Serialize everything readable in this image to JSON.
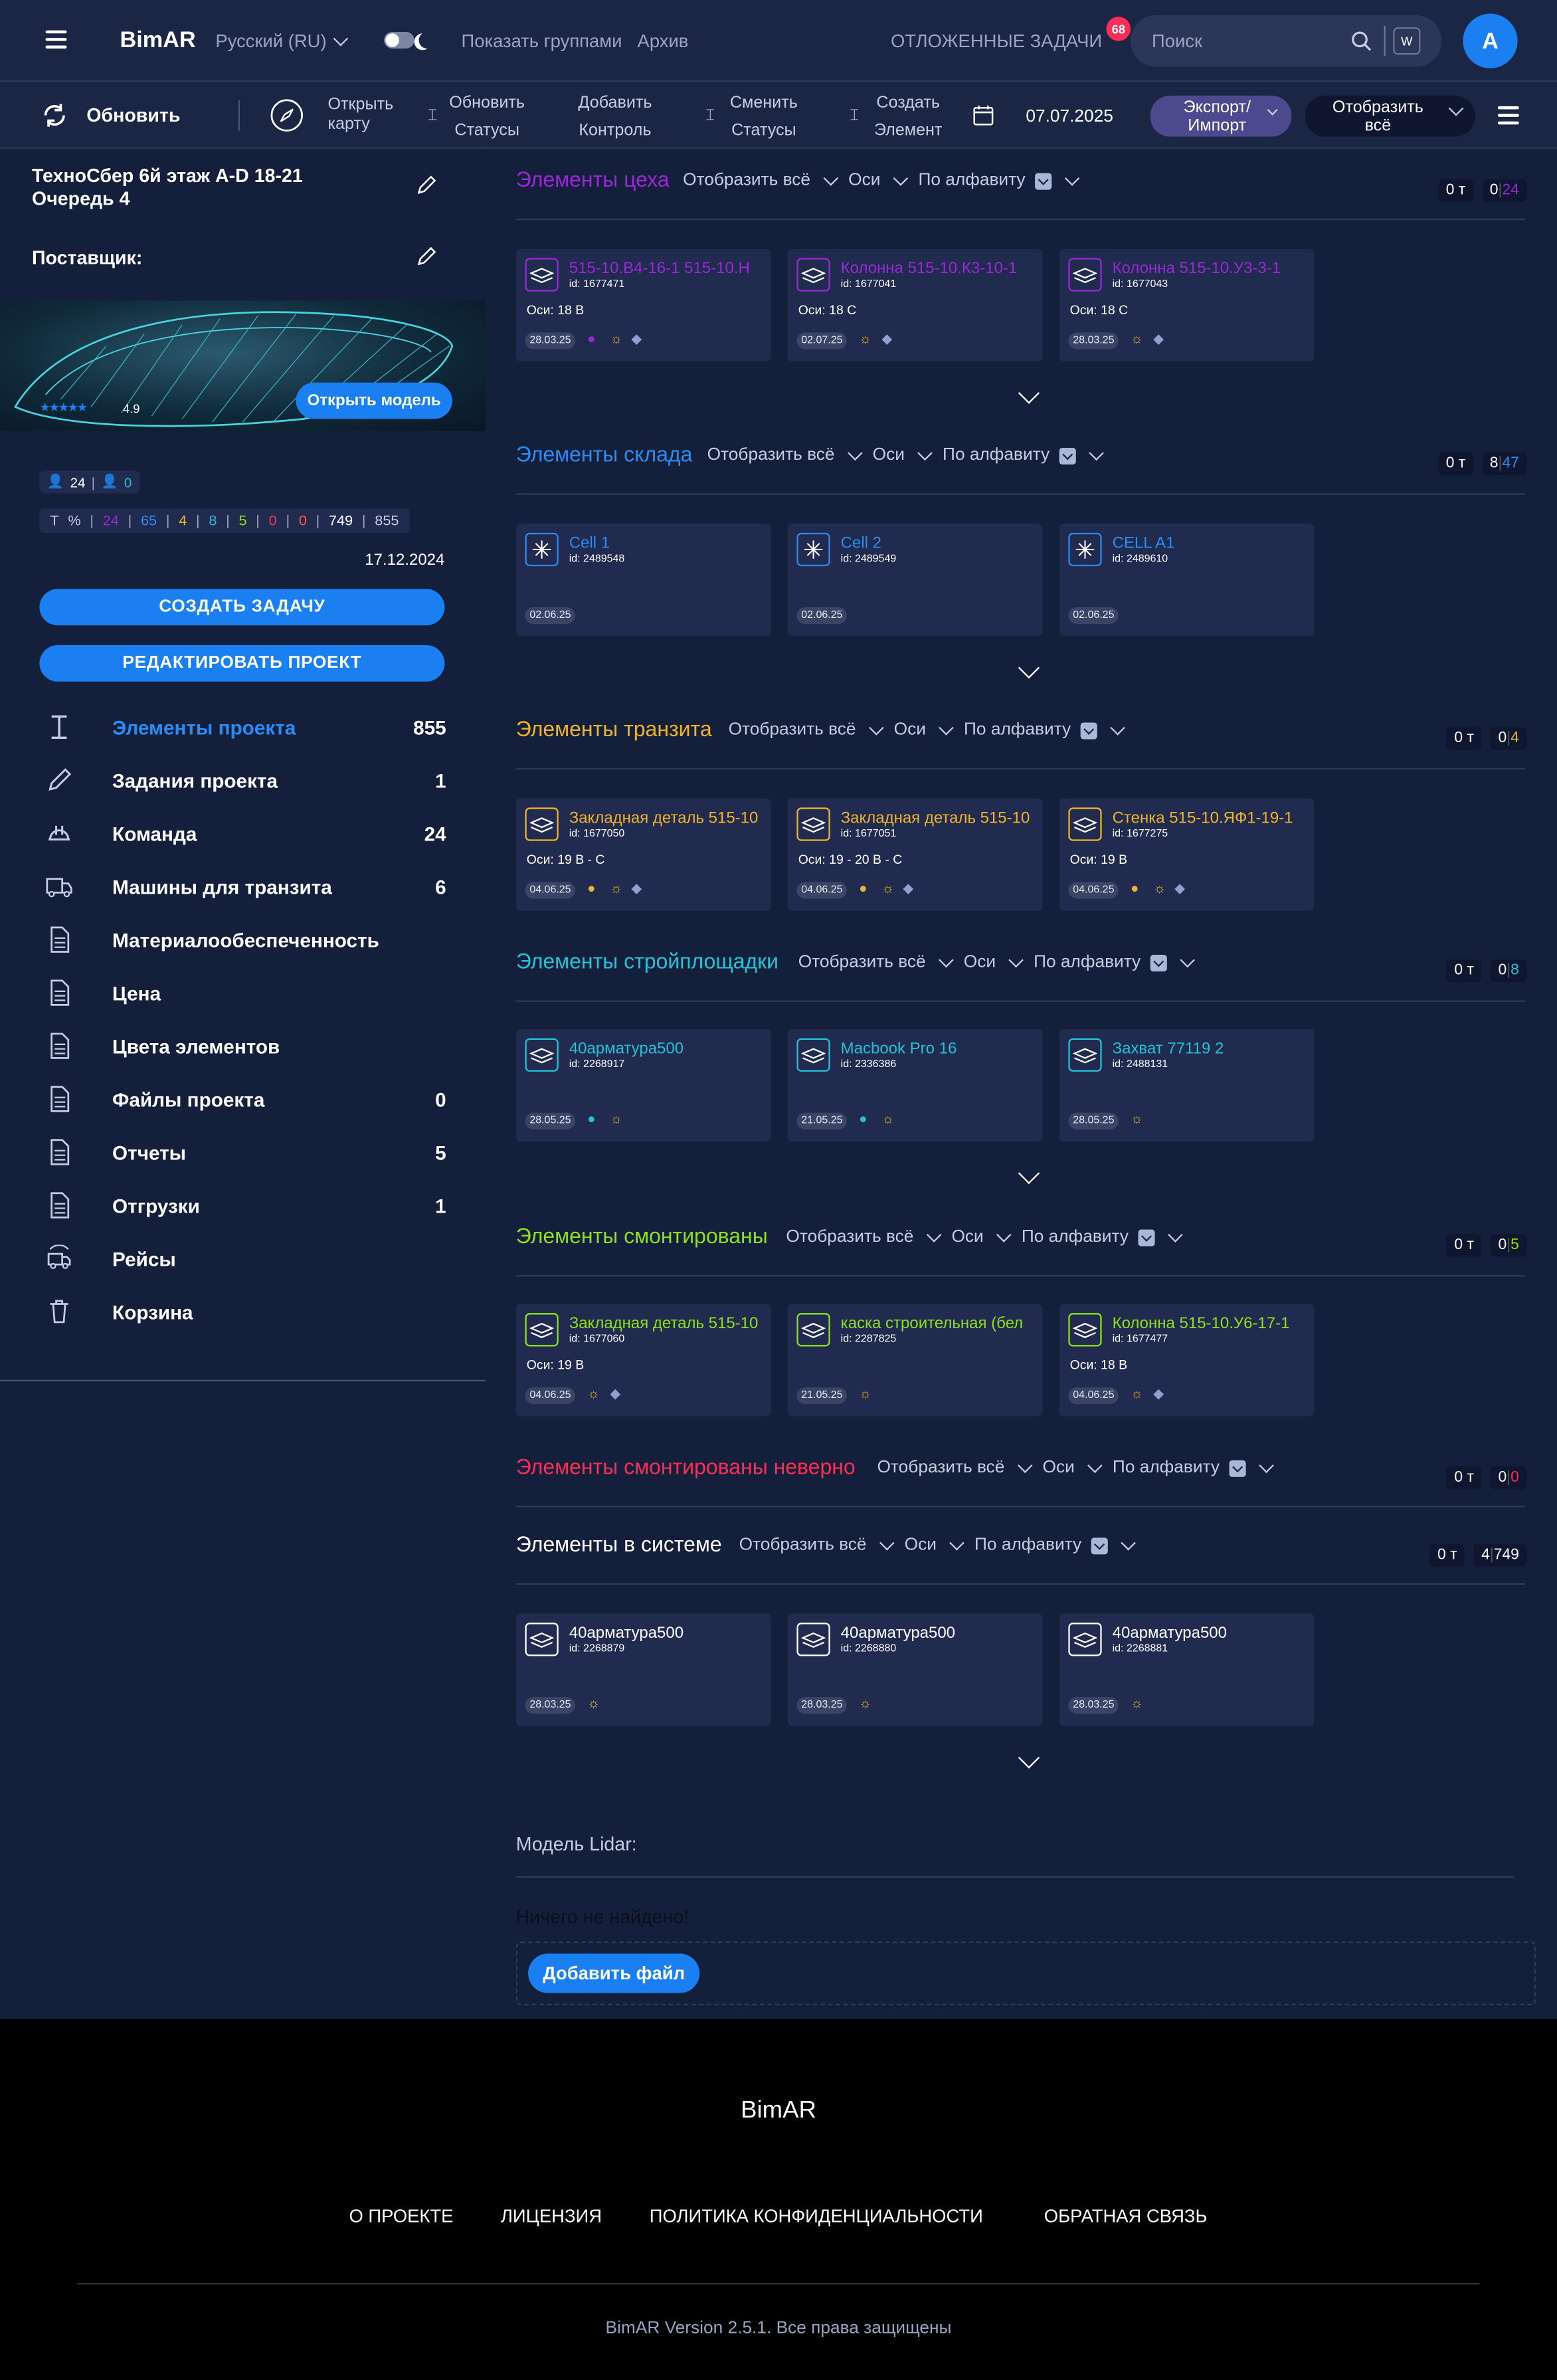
{
  "topbar": {
    "brand": "BimAR",
    "language": "Русский (RU)",
    "show_groups": "Показать группами",
    "archive": "Архив",
    "deferred_tasks": "ОТЛОЖЕННЫЕ ЗАДАЧИ",
    "deferred_count": "68",
    "search_placeholder": "Поиск",
    "search_key": "W",
    "avatar": "A"
  },
  "toolbar": {
    "refresh": "Обновить",
    "open_map": [
      "Открыть",
      "карту"
    ],
    "update_statuses": [
      "Обновить",
      "Статусы"
    ],
    "add_control": [
      "Добавить",
      "Контроль"
    ],
    "change_statuses": [
      "Сменить",
      "Статусы"
    ],
    "create_element": [
      "Создать",
      "Элемент"
    ],
    "date": "07.07.2025",
    "export_import": [
      "Экспорт/",
      "Импорт"
    ],
    "show_all": [
      "Отобразить",
      "всё"
    ]
  },
  "project": {
    "title": "ТехноСбер 6й этаж A-D 18-21",
    "queue": "Очередь 4",
    "supplier_label": "Поставщик:",
    "rating": "4.9",
    "open_model": "Открыть модель",
    "members": "24",
    "members_active": "0",
    "stats": [
      "Т",
      "%",
      "24",
      "65",
      "4",
      "8",
      "5",
      "0",
      "0",
      "749",
      "855"
    ],
    "date": "17.12.2024",
    "create_task": "СОЗДАТЬ ЗАДАЧУ",
    "edit_project": "РЕДАКТИРОВАТЬ ПРОЕКТ"
  },
  "nav": [
    {
      "label": "Элементы проекта",
      "count": "855"
    },
    {
      "label": "Задания проекта",
      "count": "1"
    },
    {
      "label": "Команда",
      "count": "24"
    },
    {
      "label": "Машины для транзита",
      "count": "6"
    },
    {
      "label": "Материалообеспеченность",
      "count": ""
    },
    {
      "label": "Цена",
      "count": ""
    },
    {
      "label": "Цвета элементов",
      "count": ""
    },
    {
      "label": "Файлы проекта",
      "count": "0"
    },
    {
      "label": "Отчеты",
      "count": "5"
    },
    {
      "label": "Отгрузки",
      "count": "1"
    },
    {
      "label": "Рейсы",
      "count": ""
    },
    {
      "label": "Корзина",
      "count": ""
    }
  ],
  "filters": {
    "show_all": "Отобразить всё",
    "axes": "Оси",
    "alpha": "По алфавиту"
  },
  "sections": [
    {
      "title": "Элементы цеха",
      "color": "#9b27d9",
      "tons": "0 т",
      "count": "0",
      "total": "24",
      "cards": [
        {
          "title": "515-10.В4-16-1 515-10.Н",
          "id": "id: 1677471",
          "axes": "Оси: 18 В",
          "date": "28.03.25"
        },
        {
          "title": "Колонна 515-10.К3-10-1",
          "id": "id: 1677041",
          "axes": "Оси: 18 С",
          "date": "02.07.25"
        },
        {
          "title": "Колонна 515-10.У3-3-1",
          "id": "id: 1677043",
          "axes": "Оси: 18 С",
          "date": "28.03.25"
        }
      ]
    },
    {
      "title": "Элементы склада",
      "color": "#2a8cf2",
      "tons": "0 т",
      "count": "8",
      "total": "47",
      "cards": [
        {
          "title": "Cell 1",
          "id": "id: 2489548",
          "axes": "",
          "date": "02.06.25"
        },
        {
          "title": "Cell 2",
          "id": "id: 2489549",
          "axes": "",
          "date": "02.06.25"
        },
        {
          "title": "CELL A1",
          "id": "id: 2489610",
          "axes": "",
          "date": "02.06.25"
        }
      ]
    },
    {
      "title": "Элементы транзита",
      "color": "#f0b429",
      "tons": "0 т",
      "count": "0",
      "total": "4",
      "cards": [
        {
          "title": "Закладная деталь 515-10",
          "id": "id: 1677050",
          "axes": "Оси: 19 В - С",
          "date": "04.06.25"
        },
        {
          "title": "Закладная деталь 515-10",
          "id": "id: 1677051",
          "axes": "Оси: 19 - 20 В - С",
          "date": "04.06.25"
        },
        {
          "title": "Стенка 515-10.ЯФ1-19-1",
          "id": "id: 1677275",
          "axes": "Оси: 19 В",
          "date": "04.06.25"
        }
      ]
    },
    {
      "title": "Элементы стройплощадки",
      "color": "#22c3d6",
      "tons": "0 т",
      "count": "0",
      "total": "8",
      "cards": [
        {
          "title": "40арматура500",
          "id": "id: 2268917",
          "axes": "",
          "date": "28.05.25"
        },
        {
          "title": "Macbook Pro 16",
          "id": "id: 2336386",
          "axes": "",
          "date": "21.05.25"
        },
        {
          "title": "Захват 77119 2",
          "id": "id: 2488131",
          "axes": "",
          "date": "28.05.25"
        }
      ]
    },
    {
      "title": "Элементы смонтированы",
      "color": "#8ee21a",
      "tons": "0 т",
      "count": "0",
      "total": "5",
      "cards": [
        {
          "title": "Закладная деталь 515-10",
          "id": "id: 1677060",
          "axes": "Оси: 19 В",
          "date": "04.06.25"
        },
        {
          "title": "каска строительная (бел",
          "id": "id: 2287825",
          "axes": "",
          "date": "21.05.25"
        },
        {
          "title": "Колонна 515-10.У6-17-1",
          "id": "id: 1677477",
          "axes": "Оси: 18 В",
          "date": "04.06.25"
        }
      ]
    },
    {
      "title": "Элементы смонтированы неверно",
      "color": "#ff2d55",
      "tons": "0 т",
      "count": "0",
      "total": "0",
      "cards": []
    },
    {
      "title": "Элементы в системе",
      "color": "#ffffff",
      "tons": "0 т",
      "count": "4",
      "total": "749",
      "cards": [
        {
          "title": "40арматура500",
          "id": "id: 2268879",
          "axes": "",
          "date": "28.03.25"
        },
        {
          "title": "40арматура500",
          "id": "id: 2268880",
          "axes": "",
          "date": "28.03.25"
        },
        {
          "title": "40арматура500",
          "id": "id: 2268881",
          "axes": "",
          "date": "28.03.25"
        }
      ]
    }
  ],
  "lidar": {
    "label": "Модель Lidar:",
    "empty": "Ничего не найдено!",
    "add_file": "Добавить файл"
  },
  "footer": {
    "brand": "BimAR",
    "links": [
      "О ПРОЕКТЕ",
      "ЛИЦЕНЗИЯ",
      "ПОЛИТИКА КОНФИДЕНЦИАЛЬНОСТИ",
      "ОБРАТНАЯ СВЯЗЬ"
    ],
    "version": "BimAR Version 2.5.1. Все права защищены"
  }
}
